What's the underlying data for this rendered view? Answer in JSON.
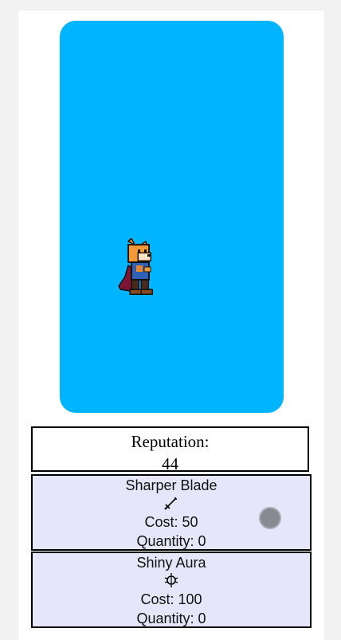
{
  "colors": {
    "game_bg": "#00b4ff",
    "upgrade_bg": "#e6e6fa",
    "button": "#888a92"
  },
  "reputation": {
    "label": "Reputation:",
    "value": "44"
  },
  "upgrades": [
    {
      "name": "Sharper Blade",
      "icon": "sword-icon",
      "cost": "Cost: 50",
      "quantity": "Quantity: 0"
    },
    {
      "name": "Shiny Aura",
      "icon": "aura-icon",
      "cost": "Cost: 100",
      "quantity": "Quantity: 0"
    }
  ]
}
